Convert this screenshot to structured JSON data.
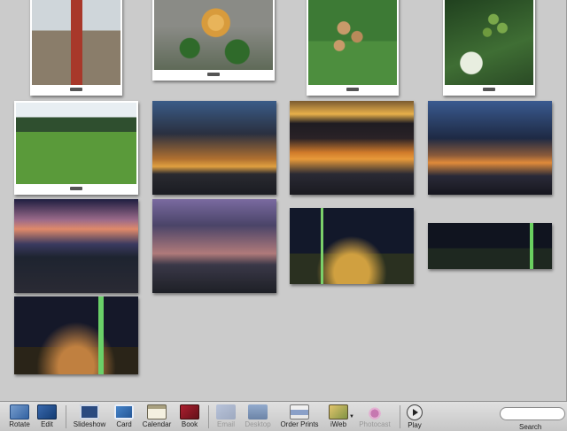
{
  "photos": [
    {
      "name": "photo-red-door",
      "style": "framed",
      "paint": "p-door"
    },
    {
      "name": "photo-flower",
      "style": "framed",
      "paint": "p-flower"
    },
    {
      "name": "photo-longan-fruit",
      "style": "framed",
      "paint": "p-longan"
    },
    {
      "name": "photo-coffee-beans",
      "style": "framed",
      "paint": "p-coffee"
    },
    {
      "name": "photo-grass-field",
      "style": "framed",
      "paint": "p-field"
    },
    {
      "name": "photo-sunset-clouds-1",
      "style": "plain",
      "paint": "p-sun1"
    },
    {
      "name": "photo-sunset-clouds-2",
      "style": "plain",
      "paint": "p-sun2"
    },
    {
      "name": "photo-sunset-clouds-3",
      "style": "plain",
      "paint": "p-sun3"
    },
    {
      "name": "photo-dusk-city-1",
      "style": "plain",
      "paint": "p-dusk1"
    },
    {
      "name": "photo-dusk-city-2",
      "style": "plain",
      "paint": "p-dusk2"
    },
    {
      "name": "photo-taipei-101-night-1",
      "style": "plain",
      "paint": "p-city1"
    },
    {
      "name": "photo-taipei-101-night-2",
      "style": "plain",
      "paint": "p-city2"
    },
    {
      "name": "photo-taipei-101-night-3",
      "style": "plain",
      "paint": "p-city3"
    }
  ],
  "toolbar": {
    "rotate": "Rotate",
    "edit": "Edit",
    "slideshow": "Slideshow",
    "card": "Card",
    "calendar": "Calendar",
    "book": "Book",
    "email": "Email",
    "desktop": "Desktop",
    "order_prints": "Order Prints",
    "iweb": "iWeb",
    "photocast": "Photocast",
    "play": "Play",
    "search_label": "Search",
    "search_value": ""
  }
}
